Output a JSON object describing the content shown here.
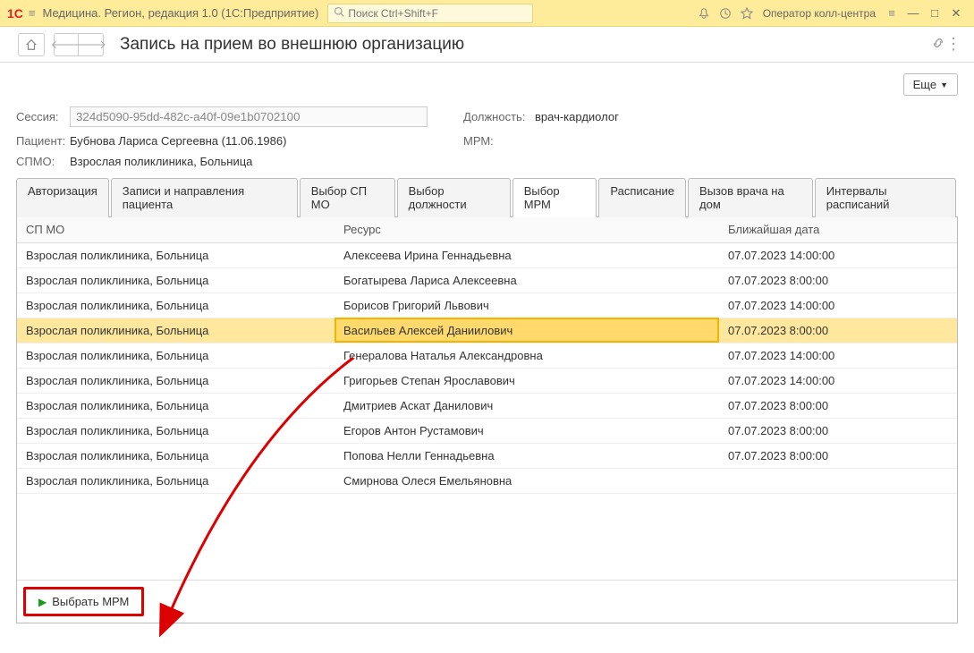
{
  "titlebar": {
    "app_title": "Медицина. Регион, редакция 1.0  (1С:Предприятие)",
    "search_placeholder": "Поиск Ctrl+Shift+F",
    "user_label": "Оператор колл-центра"
  },
  "page": {
    "title": "Запись на прием во внешнюю организацию",
    "more_btn": "Еще"
  },
  "form": {
    "session_label": "Сессия:",
    "session_value": "324d5090-95dd-482c-a40f-09e1b0702100",
    "position_label": "Должность:",
    "position_value": "врач-кардиолог",
    "patient_label": "Пациент:",
    "patient_value": "Бубнова Лариса Сергеевна (11.06.1986)",
    "mrm_label": "МРМ:",
    "mrm_value": "",
    "spmo_label": "СПМО:",
    "spmo_value": "Взрослая поликлиника, Больница"
  },
  "tabs": [
    {
      "label": "Авторизация"
    },
    {
      "label": "Записи и направления пациента"
    },
    {
      "label": "Выбор СП МО"
    },
    {
      "label": "Выбор должности"
    },
    {
      "label": "Выбор МРМ"
    },
    {
      "label": "Расписание"
    },
    {
      "label": "Вызов врача на дом"
    },
    {
      "label": "Интервалы расписаний"
    }
  ],
  "table": {
    "headers": {
      "spmo": "СП МО",
      "resource": "Ресурс",
      "date": "Ближайшая дата"
    },
    "rows": [
      {
        "spmo": "Взрослая поликлиника, Больница",
        "resource": "Алексеева Ирина Геннадьевна",
        "date": "07.07.2023 14:00:00"
      },
      {
        "spmo": "Взрослая поликлиника, Больница",
        "resource": "Богатырева Лариса Алексеевна",
        "date": "07.07.2023 8:00:00"
      },
      {
        "spmo": "Взрослая поликлиника, Больница",
        "resource": "Борисов Григорий Львович",
        "date": "07.07.2023 14:00:00"
      },
      {
        "spmo": "Взрослая поликлиника, Больница",
        "resource": "Васильев Алексей Даниилович",
        "date": "07.07.2023 8:00:00"
      },
      {
        "spmo": "Взрослая поликлиника, Больница",
        "resource": "Генералова Наталья Александровна",
        "date": "07.07.2023 14:00:00"
      },
      {
        "spmo": "Взрослая поликлиника, Больница",
        "resource": "Григорьев Степан Ярославович",
        "date": "07.07.2023 14:00:00"
      },
      {
        "spmo": "Взрослая поликлиника, Больница",
        "resource": "Дмитриев Аскат Данилович",
        "date": "07.07.2023 8:00:00"
      },
      {
        "spmo": "Взрослая поликлиника, Больница",
        "resource": "Егоров Антон Рустамович",
        "date": "07.07.2023 8:00:00"
      },
      {
        "spmo": "Взрослая поликлиника, Больница",
        "resource": "Попова Нелли Геннадьевна",
        "date": "07.07.2023 8:00:00"
      },
      {
        "spmo": "Взрослая поликлиника, Больница",
        "resource": "Смирнова Олеся Емельяновна",
        "date": ""
      }
    ],
    "selected_index": 3
  },
  "footer": {
    "select_btn": "Выбрать МРМ"
  }
}
